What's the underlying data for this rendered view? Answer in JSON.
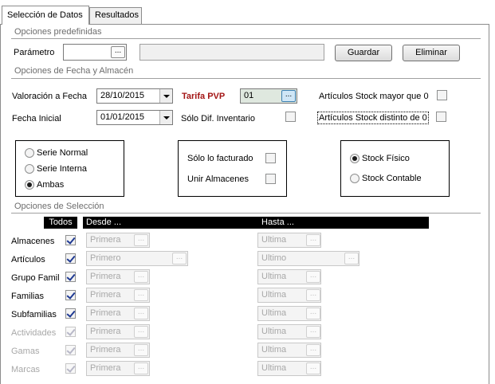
{
  "tabs": [
    {
      "label": "Selección de Datos"
    },
    {
      "label": "Resultados"
    }
  ],
  "predef": {
    "title": "Opciones predefinidas",
    "parametro_label": "Parámetro",
    "parametro_value": "",
    "descripcion_value": "",
    "guardar_label": "Guardar",
    "eliminar_label": "Eliminar"
  },
  "ellipsis": "...",
  "fecha": {
    "title": "Opciones de Fecha y Almacén",
    "valoracion_label": "Valoración a Fecha",
    "valoracion_value": "28/10/2015",
    "fecha_inicial_label": "Fecha Inicial",
    "fecha_inicial_value": "01/01/2015",
    "tarifa_label": "Tarifa PVP",
    "tarifa_value": "01",
    "solo_dif_label": "Sólo Dif. Inventario",
    "stock_mayor_label": "Artículos Stock mayor que 0",
    "stock_distinto_label": "Artículos Stock distinto de 0"
  },
  "serie": {
    "normal": "Serie Normal",
    "interna": "Serie Interna",
    "ambas": "Ambas"
  },
  "facturado": {
    "solo_facturado": "Sólo lo facturado",
    "unir_almacenes": "Unir Almacenes"
  },
  "stock": {
    "fisico": "Stock Físico",
    "contable": "Stock Contable"
  },
  "seleccion": {
    "title": "Opciones de Selección",
    "todos": "Todos",
    "desde": "Desde ...",
    "hasta": "Hasta ...",
    "rows": [
      {
        "label": "Almacenes",
        "desde": "Primera",
        "hasta": "Ultima"
      },
      {
        "label": "Artículos",
        "desde": "Primero",
        "hasta": "Ultimo"
      },
      {
        "label": "Grupo Famil",
        "desde": "Primera",
        "hasta": "Ultima"
      },
      {
        "label": "Familias",
        "desde": "Primera",
        "hasta": "Ultima"
      },
      {
        "label": "Subfamilias",
        "desde": "Primera",
        "hasta": "Ultima"
      },
      {
        "label": "Actividades",
        "desde": "Primera",
        "hasta": "Ultima"
      },
      {
        "label": "Gamas",
        "desde": "Primera",
        "hasta": "Ultima"
      },
      {
        "label": "Marcas",
        "desde": "Primera",
        "hasta": "Ultima"
      }
    ]
  }
}
